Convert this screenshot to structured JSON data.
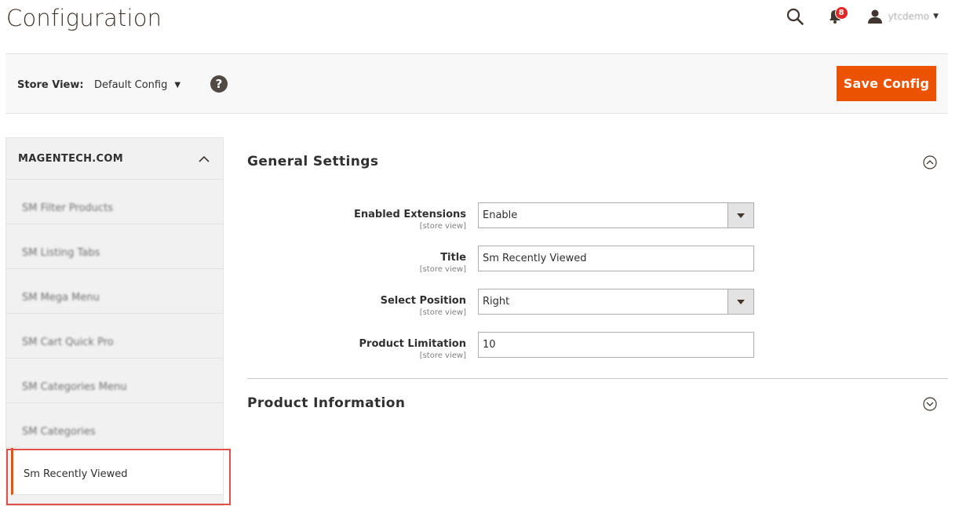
{
  "header": {
    "title": "Configuration",
    "notification_count": "8",
    "username": "ytcdemo"
  },
  "store_bar": {
    "label": "Store View:",
    "selected": "Default Config",
    "help": "?",
    "save_label": "Save Config"
  },
  "sidebar": {
    "group_title": "MAGENTECH.COM",
    "items": [
      {
        "label": "SM Filter Products"
      },
      {
        "label": "SM Listing Tabs"
      },
      {
        "label": "SM Mega Menu"
      },
      {
        "label": "SM Cart Quick Pro"
      },
      {
        "label": "SM Categories Menu"
      },
      {
        "label": "SM Categories"
      },
      {
        "label": "Sm Recently Viewed"
      }
    ],
    "active_index": 6
  },
  "main": {
    "general_settings": {
      "title": "General Settings",
      "fields": [
        {
          "label": "Enabled Extensions",
          "scope": "[store view]",
          "value": "Enable",
          "type": "select"
        },
        {
          "label": "Title",
          "scope": "[store view]",
          "value": "Sm Recently Viewed",
          "type": "text"
        },
        {
          "label": "Select Position",
          "scope": "[store view]",
          "value": "Right",
          "type": "select"
        },
        {
          "label": "Product Limitation",
          "scope": "[store view]",
          "value": "10",
          "type": "text"
        }
      ]
    },
    "product_information": {
      "title": "Product Information"
    }
  },
  "colors": {
    "accent": "#eb5202",
    "badge": "#e22626",
    "highlight": "#e0504a"
  }
}
